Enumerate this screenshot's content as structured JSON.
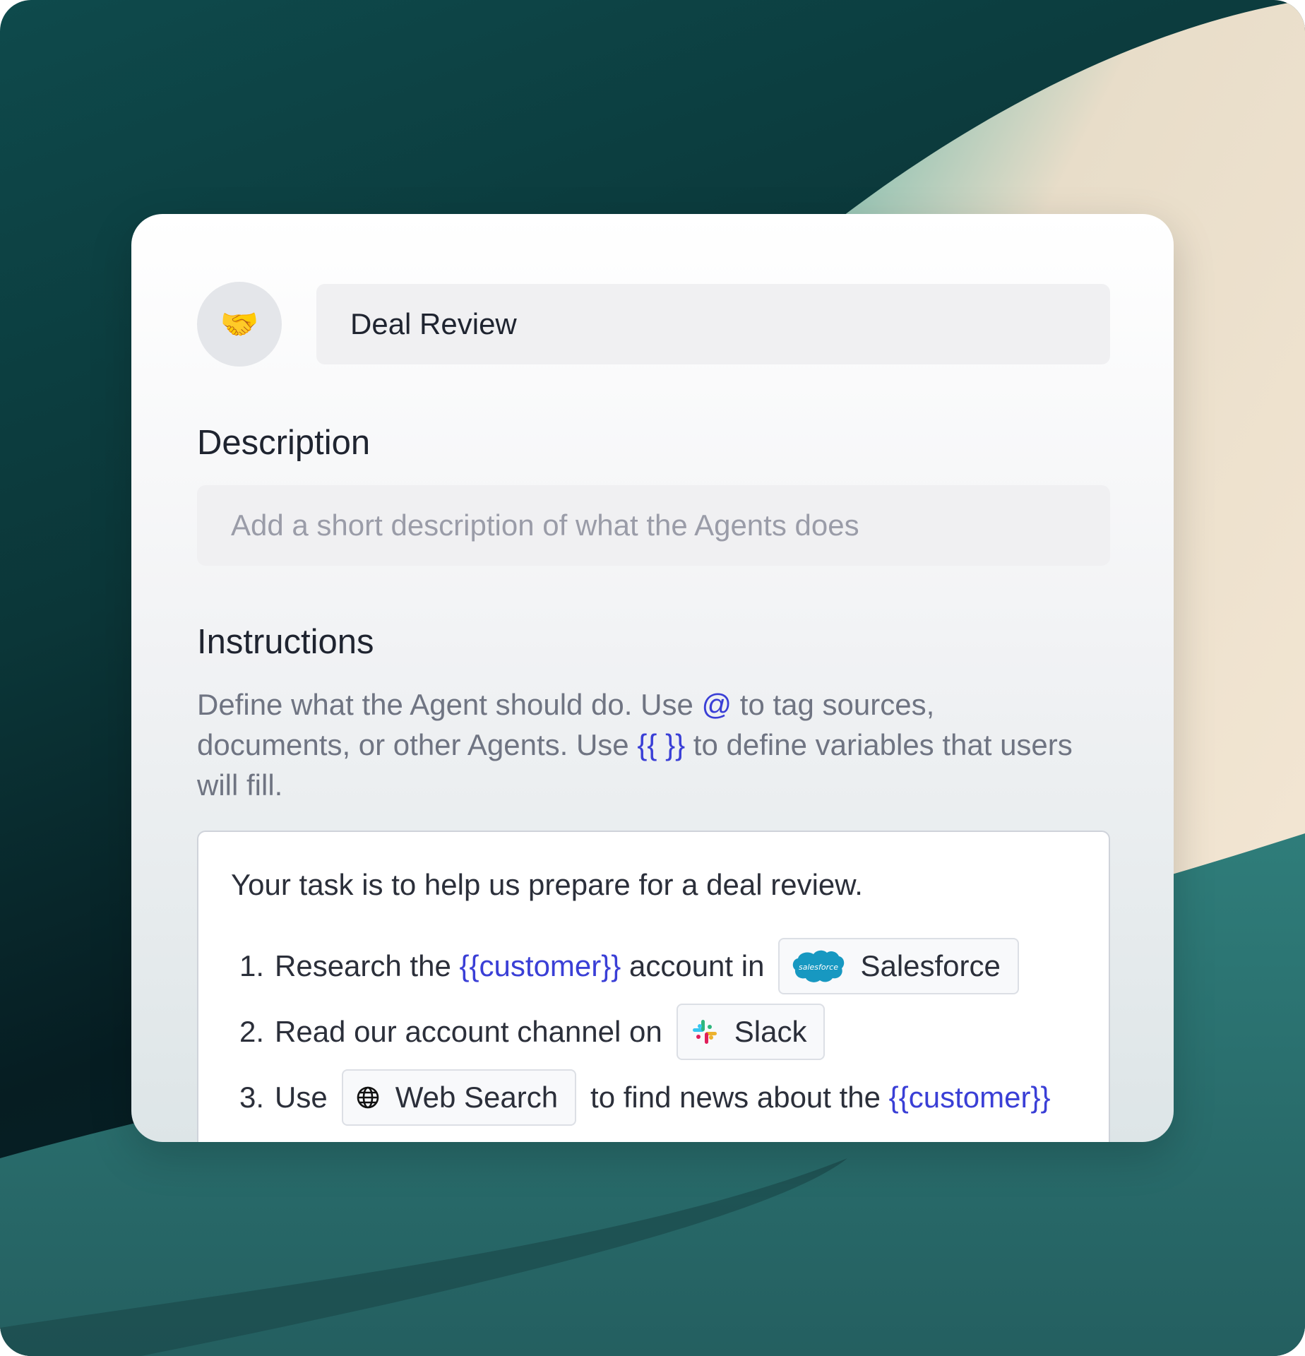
{
  "agent": {
    "avatar_emoji": "🤝",
    "name": "Deal Review"
  },
  "description": {
    "label": "Description",
    "placeholder": "Add a short description of what the Agents does"
  },
  "instructions": {
    "label": "Instructions",
    "helper": {
      "part1": "Define what the Agent should do. Use ",
      "at_symbol": "@",
      "part2": " to tag sources, documents, or other Agents. Use ",
      "braces": "{{ }}",
      "part3": " to define variables that users will fill."
    },
    "editor": {
      "intro": "Your task is to help us prepare for a deal review.",
      "steps": [
        {
          "number": "1.",
          "text_before": "Research the ",
          "variable": "{{customer}}",
          "text_after": " account in",
          "chip": {
            "label": "Salesforce",
            "icon": "salesforce-icon",
            "icon_text": "salesforce"
          }
        },
        {
          "number": "2.",
          "text_before": "Read our account channel on",
          "chip": {
            "label": "Slack",
            "icon": "slack-icon"
          }
        },
        {
          "number": "3.",
          "text_before": "Use",
          "chip": {
            "label": "Web Search",
            "icon": "globe-icon"
          },
          "text_after": "to find news about the ",
          "variable": "{{customer}}"
        }
      ]
    }
  },
  "colors": {
    "accent": "#3a3fd6",
    "salesforce_blue": "#1798c1",
    "background_teal": "#0e4a4c"
  }
}
